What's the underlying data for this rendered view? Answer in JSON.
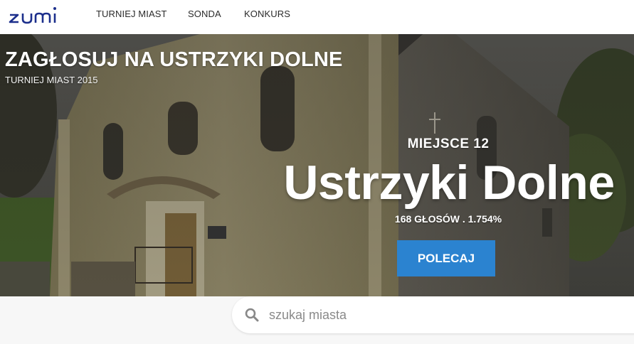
{
  "brand": {
    "logo_text": "zumi",
    "logo_color": "#1c2f8c",
    "accent_color": "#2b83d0"
  },
  "nav": {
    "items": [
      {
        "label": "TURNIEJ MIAST"
      },
      {
        "label": "SONDA"
      },
      {
        "label": "KONKURS"
      }
    ]
  },
  "hero": {
    "title": "ZAGŁOSUJ NA USTRZYKI DOLNE",
    "subtitle": "TURNIEJ MIAST 2015",
    "rank": "MIEJSCE 12",
    "city": "Ustrzyki Dolne",
    "votes": "168 GŁOSÓW . 1.754%",
    "button_label": "POLECAJ"
  },
  "search": {
    "placeholder": "szukaj miasta",
    "icon": "search-icon"
  }
}
